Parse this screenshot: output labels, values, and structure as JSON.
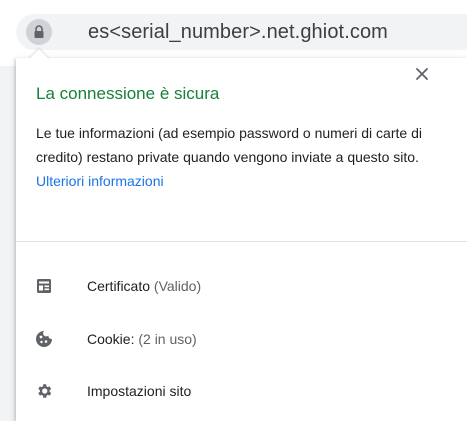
{
  "address_bar": {
    "url": "es<serial_number>.net.ghiot.com",
    "lock_icon": "lock-icon"
  },
  "popup": {
    "title": "La connessione è sicura",
    "description": "Le tue informazioni (ad esempio password o numeri di carte di credito) restano private quando vengono inviate a questo sito.",
    "more_info_link": "Ulteriori informazioni",
    "close_icon": "close-icon",
    "colors": {
      "title": "#188038",
      "link": "#1a73e8"
    },
    "items": [
      {
        "icon": "certificate-icon",
        "label": "Certificato",
        "detail": "(Valido)"
      },
      {
        "icon": "cookie-icon",
        "label": "Cookie:",
        "detail": "(2 in uso)"
      },
      {
        "icon": "gear-icon",
        "label": "Impostazioni sito",
        "detail": ""
      }
    ]
  }
}
